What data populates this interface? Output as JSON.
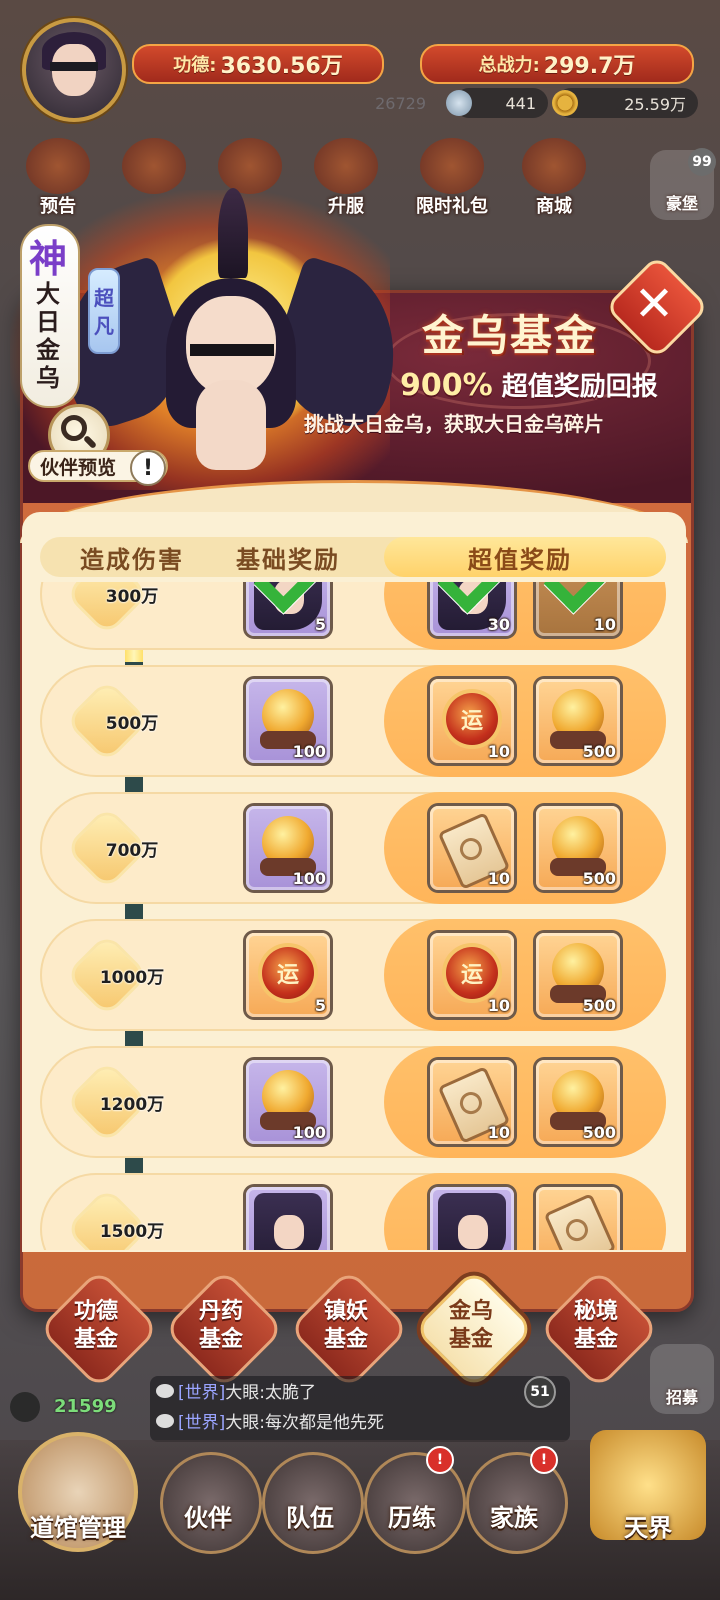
{
  "hud": {
    "merit_label": "功德:",
    "merit_value": "3630.56万",
    "power_label": "总战力:",
    "power_value": "299.7万",
    "res_faded": "26729",
    "res_pearl": "441",
    "res_gold": "25.59万",
    "top_icons": [
      "预告",
      "",
      "",
      "升服",
      "限时礼包",
      "商城"
    ],
    "side_top_label": "豪堡",
    "side_top_badge": "99"
  },
  "hero": {
    "rank_char": "神",
    "name": "大日金乌",
    "quality": "超凡",
    "preview_label": "伙伴预览",
    "alert_glyph": "!"
  },
  "fund": {
    "title": "金乌基金",
    "percent": "900%",
    "subtitle": "超值奖励回报",
    "description": "挑战大日金乌，获取大日金乌碎片",
    "close_glyph": "✕"
  },
  "table": {
    "headers": [
      "造成伤害",
      "基础奖励",
      "超值奖励"
    ],
    "rows": [
      {
        "threshold": "300万",
        "base": {
          "kind": "shard",
          "count": "5",
          "claimed": true
        },
        "super": [
          {
            "kind": "shard",
            "count": "30",
            "claimed": true
          },
          {
            "kind": "box",
            "count": "10",
            "claimed": true
          }
        ]
      },
      {
        "threshold": "500万",
        "base": {
          "kind": "orb",
          "count": "100"
        },
        "super": [
          {
            "kind": "luck",
            "count": "10"
          },
          {
            "kind": "orb",
            "count": "500"
          }
        ]
      },
      {
        "threshold": "700万",
        "base": {
          "kind": "orb",
          "count": "100"
        },
        "super": [
          {
            "kind": "scroll",
            "count": "10"
          },
          {
            "kind": "orb",
            "count": "500"
          }
        ]
      },
      {
        "threshold": "1000万",
        "base": {
          "kind": "luck",
          "count": "5"
        },
        "super": [
          {
            "kind": "luck",
            "count": "10"
          },
          {
            "kind": "orb",
            "count": "500"
          }
        ]
      },
      {
        "threshold": "1200万",
        "base": {
          "kind": "orb",
          "count": "100"
        },
        "super": [
          {
            "kind": "scroll",
            "count": "10"
          },
          {
            "kind": "orb",
            "count": "500"
          }
        ]
      },
      {
        "threshold": "1500万",
        "base": {
          "kind": "shard",
          "count": ""
        },
        "super": [
          {
            "kind": "shard",
            "count": ""
          },
          {
            "kind": "scroll",
            "count": ""
          }
        ]
      }
    ],
    "luck_char": "运",
    "progress_percent": 12
  },
  "tabs": [
    {
      "label_top": "功德",
      "label_bottom": "基金",
      "active": false
    },
    {
      "label_top": "丹药",
      "label_bottom": "基金",
      "active": false
    },
    {
      "label_top": "镇妖",
      "label_bottom": "基金",
      "active": false
    },
    {
      "label_top": "金乌",
      "label_bottom": "基金",
      "active": true
    },
    {
      "label_top": "秘境",
      "label_bottom": "基金",
      "active": false
    }
  ],
  "chat": {
    "lines": [
      {
        "channel": "[世界]",
        "text": "大眼:太脆了"
      },
      {
        "channel": "[世界]",
        "text": "大眼:每次都是他先死"
      }
    ],
    "badge": "51",
    "gold_count": "21599"
  },
  "side_bottom": {
    "recruit_label": "招募"
  },
  "nav": {
    "dojo": "道馆管理",
    "partner": "伙伴",
    "team": "队伍",
    "training": "历练",
    "family": "家族",
    "heaven": "天界",
    "alert_glyph": "!"
  },
  "colors": {
    "panel_red": "#6b2233",
    "panel_orange": "#c96a3b",
    "table_cream": "#fbf0d4",
    "super_highlight": "#ffb55a",
    "check_green": "#35b33a",
    "progress_track": "#2d4a4a",
    "progress_fill": "#ffe06a"
  }
}
